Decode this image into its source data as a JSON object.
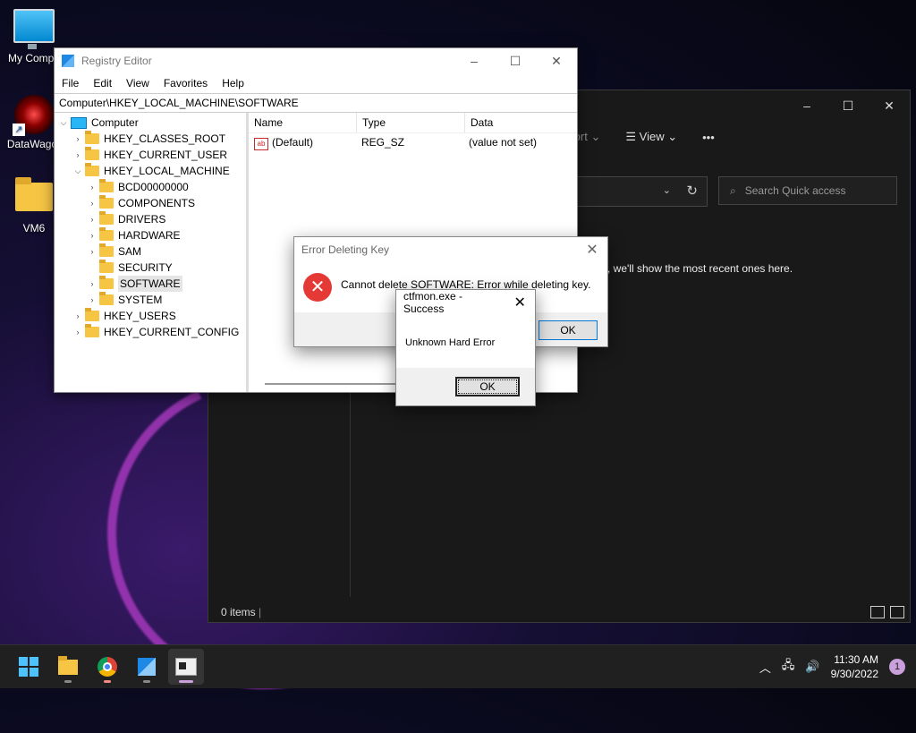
{
  "desktop": {
    "icons": [
      {
        "label": "My Compu"
      },
      {
        "label": "DataWagor"
      },
      {
        "label": "VM6"
      }
    ]
  },
  "explorer": {
    "toolbar": {
      "sort": "Sort",
      "view": "View",
      "more": "•••"
    },
    "search_placeholder": "Search Quick access",
    "empty_message": "s, we'll show the most recent ones here.",
    "status": "0 items"
  },
  "regedit": {
    "title": "Registry Editor",
    "menu": [
      "File",
      "Edit",
      "View",
      "Favorites",
      "Help"
    ],
    "address": "Computer\\HKEY_LOCAL_MACHINE\\SOFTWARE",
    "tree": {
      "root": "Computer",
      "hkcr": "HKEY_CLASSES_ROOT",
      "hkcu": "HKEY_CURRENT_USER",
      "hklm": "HKEY_LOCAL_MACHINE",
      "hklm_children": [
        "BCD00000000",
        "COMPONENTS",
        "DRIVERS",
        "HARDWARE",
        "SAM",
        "SECURITY",
        "SOFTWARE",
        "SYSTEM"
      ],
      "hku": "HKEY_USERS",
      "hkcc": "HKEY_CURRENT_CONFIG"
    },
    "columns": [
      "Name",
      "Type",
      "Data"
    ],
    "rows": [
      {
        "name": "(Default)",
        "type": "REG_SZ",
        "data": "(value not set)"
      }
    ]
  },
  "error_dialog": {
    "title": "Error Deleting Key",
    "message": "Cannot delete SOFTWARE:  Error while deleting key.",
    "ok": "OK"
  },
  "success_dialog": {
    "title": "ctfmon.exe - Success",
    "message": "Unknown Hard Error",
    "ok": "OK"
  },
  "taskbar": {
    "time": "11:30 AM",
    "date": "9/30/2022",
    "notifications": "1"
  }
}
